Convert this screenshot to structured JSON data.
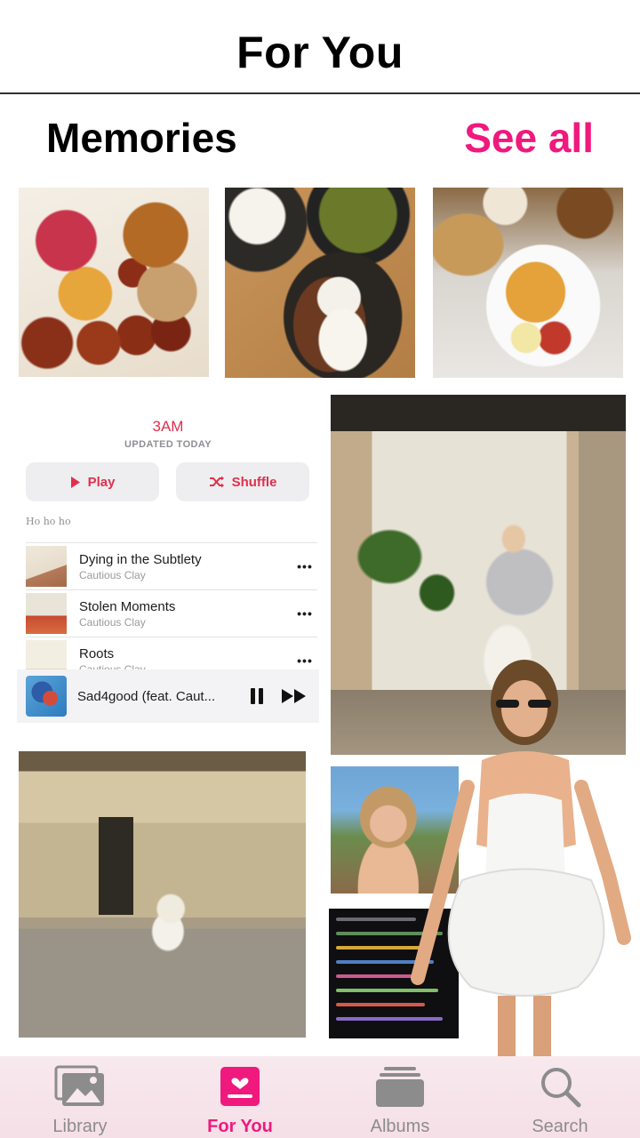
{
  "header": {
    "title": "For You"
  },
  "memories": {
    "title": "Memories",
    "see_all": "See all"
  },
  "playlist": {
    "title": "3AM",
    "updated": "UPDATED TODAY",
    "play_label": "Play",
    "shuffle_label": "Shuffle",
    "note": "Ho ho ho",
    "tracks": [
      {
        "name": "Dying in the Subtlety",
        "artist": "Cautious Clay"
      },
      {
        "name": "Stolen Moments",
        "artist": "Cautious Clay"
      },
      {
        "name": "Roots",
        "artist": "Cautious Clay"
      }
    ],
    "now_playing": "Sad4good (feat. Caut..."
  },
  "tabs": [
    {
      "label": "Library",
      "icon": "photo-library-icon",
      "active": false
    },
    {
      "label": "For You",
      "icon": "for-you-icon",
      "active": true
    },
    {
      "label": "Albums",
      "icon": "albums-icon",
      "active": false
    },
    {
      "label": "Search",
      "icon": "search-icon",
      "active": false
    }
  ],
  "colors": {
    "accent": "#f0197d",
    "music_red": "#e0304e",
    "tabbar_bg": "#f7e9ee",
    "inactive": "#8c8c8c"
  }
}
